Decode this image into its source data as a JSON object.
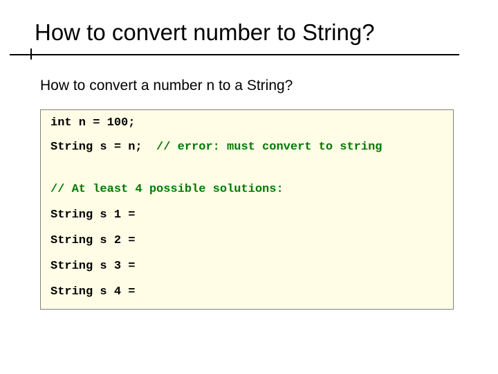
{
  "title": "How to convert number to String?",
  "subtitle": "How to convert a number n to a String?",
  "code": {
    "l1": "int n = 100;",
    "l2a": "String s = n;  ",
    "l2b": "// error: must convert to string",
    "l3": "// At least 4 possible solutions:",
    "l4": "String s 1 =",
    "l5": "String s 2 =",
    "l6": "String s 3 =",
    "l7": "String s 4 ="
  }
}
